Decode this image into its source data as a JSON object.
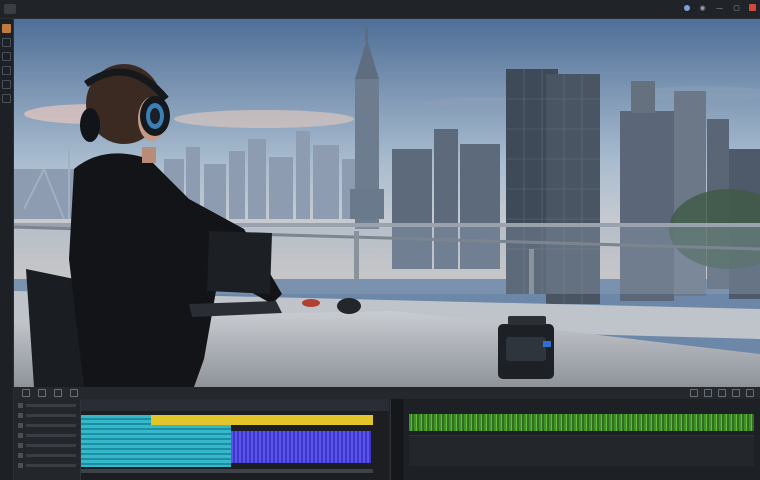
{
  "menubar": {
    "menus": [
      "",
      "",
      "",
      "",
      ""
    ]
  },
  "icons": {
    "app": "app-logo-icon",
    "minimize": "minimize-icon",
    "maximize": "maximize-icon",
    "close": "close-icon"
  },
  "colors": {
    "accent": "#c07a3a",
    "clip_cyan": "#33b9c9",
    "clip_yellow": "#e1c52b",
    "clip_blue": "#5a55e8",
    "audio_wave": "#63b83c",
    "close_button": "#d04a3a"
  }
}
